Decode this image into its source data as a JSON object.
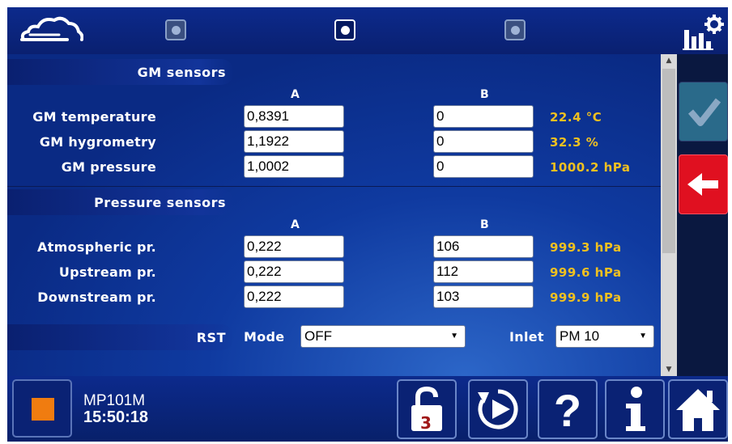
{
  "topbar": {
    "logo_icon": "cloud-icon",
    "radios": [
      {
        "name": "page-radio-1",
        "active": false
      },
      {
        "name": "page-radio-2",
        "active": true
      },
      {
        "name": "page-radio-3",
        "active": false
      }
    ],
    "stats_icon": "stats-gear-icon"
  },
  "gm": {
    "title": "GM sensors",
    "col_a": "A",
    "col_b": "B",
    "rows": [
      {
        "label": "GM temperature",
        "a": "0,8391",
        "b": "0",
        "reading": "22.4 °C"
      },
      {
        "label": "GM hygrometry",
        "a": "1,1922",
        "b": "0",
        "reading": "32.3 %"
      },
      {
        "label": "GM pressure",
        "a": "1,0002",
        "b": "0",
        "reading": "1000.2 hPa"
      }
    ]
  },
  "pressure": {
    "title": "Pressure sensors",
    "col_a": "A",
    "col_b": "B",
    "rows": [
      {
        "label": "Atmospheric pr.",
        "a": "0,222",
        "b": "106",
        "reading": "999.3 hPa"
      },
      {
        "label": "Upstream pr.",
        "a": "0,222",
        "b": "112",
        "reading": "999.6 hPa"
      },
      {
        "label": "Downstream pr.",
        "a": "0,222",
        "b": "103",
        "reading": "999.9 hPa"
      }
    ]
  },
  "rst": {
    "label": "RST",
    "mode_label": "Mode",
    "mode_value": "OFF",
    "inlet_label": "Inlet",
    "inlet_value": "PM 10"
  },
  "side": {
    "validate_icon": "checkmark-icon",
    "back_icon": "arrow-left-icon"
  },
  "bottombar": {
    "device_name": "MP101M",
    "time": "15:50:18",
    "lock_level": "3",
    "buttons": [
      "unlock-icon",
      "play-icon",
      "help-icon",
      "info-icon",
      "home-icon"
    ]
  },
  "colors": {
    "reading": "#f0c020",
    "stop": "#f07c10",
    "back_button": "#e01020",
    "validate_button": "#2a6a8a"
  }
}
